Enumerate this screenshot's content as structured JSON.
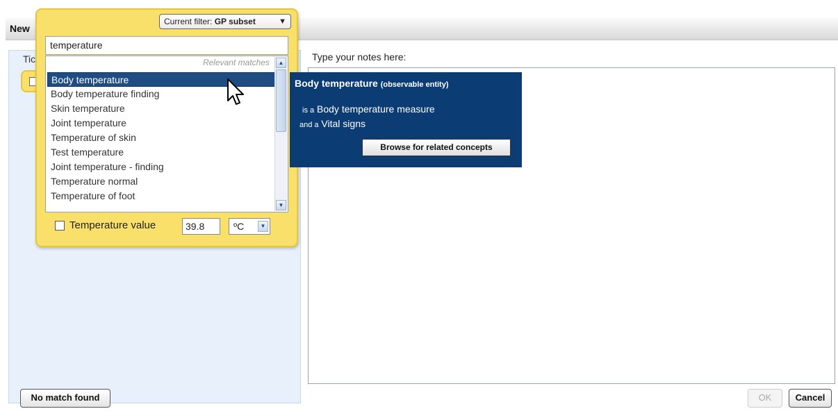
{
  "window": {
    "title": "New"
  },
  "left_panel": {
    "hint": "Tic"
  },
  "notes": {
    "label": "Type your notes here:",
    "value": ""
  },
  "popup": {
    "filter": {
      "prefix": "Current filter:",
      "value": "GP subset",
      "arrow": "▼"
    },
    "search": {
      "value": "temperature"
    },
    "relevant_label": "Relevant matches",
    "items": [
      {
        "label": "Body temperature"
      },
      {
        "label": "Body temperature finding"
      },
      {
        "label": "Skin temperature"
      },
      {
        "label": "Joint temperature"
      },
      {
        "label": "Temperature of skin"
      },
      {
        "label": "Test temperature"
      },
      {
        "label": "Joint temperature - finding"
      },
      {
        "label": "Temperature normal"
      },
      {
        "label": "Temperature of foot"
      }
    ],
    "selected_index": 0,
    "temperature": {
      "label": "Temperature value",
      "value": "39.8",
      "unit": "ºC"
    }
  },
  "info": {
    "title": "Body temperature",
    "qualifier": "(observable entity)",
    "rel1_prefix": "is a",
    "rel1_value": "Body temperature measure",
    "rel2_prefix": "and a",
    "rel2_value": "Vital signs",
    "browse_label": "Browse for related concepts"
  },
  "buttons": {
    "no_match": "No match found",
    "ok": "OK",
    "cancel": "Cancel"
  },
  "colors": {
    "popup_bg": "#f8e06a",
    "info_bg": "#0c3c74",
    "selection": "#1f4d82",
    "left_panel_bg": "#e8f1fb"
  }
}
